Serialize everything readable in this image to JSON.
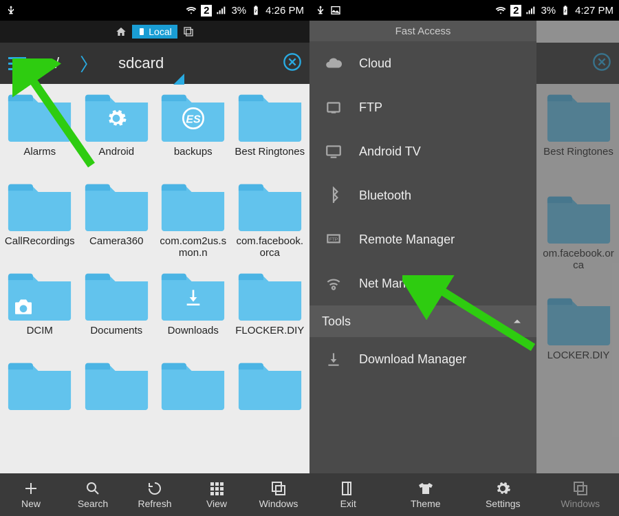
{
  "colors": {
    "accent": "#29abe2",
    "panel": "#4a4a4a"
  },
  "left": {
    "status": {
      "sim": "2",
      "battery": "3%",
      "time": "4:26 PM"
    },
    "tab": {
      "label": "Local"
    },
    "breadcrumb": {
      "root": "/",
      "current": "sdcard"
    },
    "folders": [
      {
        "name": "Alarms",
        "overlay": null
      },
      {
        "name": "Android",
        "overlay": "gear"
      },
      {
        "name": "backups",
        "overlay": "es"
      },
      {
        "name": "Best Ringtones",
        "overlay": null
      },
      {
        "name": "CallRecordings",
        "overlay": null
      },
      {
        "name": "Camera360",
        "overlay": null
      },
      {
        "name": "com.com2us.smon.n",
        "overlay": null
      },
      {
        "name": "com.facebook.orca",
        "overlay": null
      },
      {
        "name": "DCIM",
        "overlay": "camera"
      },
      {
        "name": "Documents",
        "overlay": null
      },
      {
        "name": "Downloads",
        "overlay": "download"
      },
      {
        "name": "FLOCKER.DIY",
        "overlay": null
      },
      {
        "name": "",
        "overlay": null
      },
      {
        "name": "",
        "overlay": null
      },
      {
        "name": "",
        "overlay": null
      },
      {
        "name": "",
        "overlay": null
      }
    ],
    "bottom": [
      "New",
      "Search",
      "Refresh",
      "View",
      "Windows"
    ]
  },
  "right": {
    "status": {
      "sim": "2",
      "battery": "3%",
      "time": "4:27 PM"
    },
    "panel": {
      "header": "Fast Access",
      "items": [
        "Cloud",
        "FTP",
        "Android TV",
        "Bluetooth",
        "Remote Manager",
        "Net Manager"
      ],
      "section": "Tools",
      "tools": [
        "Download Manager"
      ]
    },
    "bg_folders": [
      {
        "name": "Best Ringtones"
      },
      {
        "name": "om.facebook.orca"
      },
      {
        "name": "LOCKER.DIY"
      }
    ],
    "bottom": [
      "Exit",
      "Theme",
      "Settings",
      "Windows"
    ],
    "closevisible": true
  }
}
